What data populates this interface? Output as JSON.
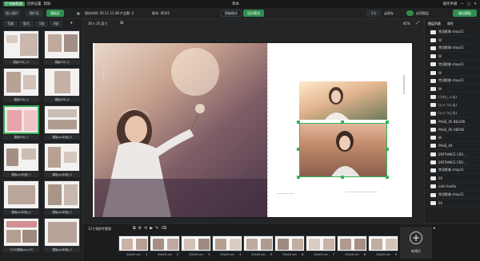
{
  "titlebar": {
    "app_label": "在线编辑器",
    "menu": [
      "在线编辑器",
      "还原设置",
      "帮助"
    ],
    "title": "草本",
    "right_label": "操作手册"
  },
  "topbar": {
    "btn_left": "图片区",
    "btn_layout": "模板区",
    "autosave": "保存时间: 03:11 11:38",
    "page_count": "产品数: 2",
    "version": "版本: 05/01",
    "mode_a": "智能模式",
    "mode_b": "设计模式",
    "zoom_select": "1:1",
    "save_btn": "云保存",
    "toggle_label": "启用图层",
    "publish_btn": "输出模板"
  },
  "leftpanel": {
    "filter_a": "写真",
    "filter_b": "版式",
    "filter_c": "1张",
    "filter_d": "4张",
    "thumbs": [
      {
        "label": "模板PSD_11"
      },
      {
        "label": "模板PSD_9"
      },
      {
        "label": "模板PSD_4"
      },
      {
        "label": "模板PSD_6"
      },
      {
        "label": "模板PSD_2"
      },
      {
        "label": "模板psd封面_8"
      },
      {
        "label": "模板psd封面_7"
      },
      {
        "label": "模板psd封面_6"
      },
      {
        "label": "模板psd封面_4"
      },
      {
        "label": "模板psd封面_5"
      },
      {
        "label": "2020模板psd_49"
      },
      {
        "label": "模板psd封面_3"
      }
    ],
    "footer": "插入图片"
  },
  "canvas": {
    "size_label": "20 x 10 英寸",
    "zoom_label": "85%"
  },
  "rightpanel": {
    "tabs": [
      "图层列表",
      "属性"
    ],
    "layers": [
      "梵语影像 shop11",
      "W",
      "梵语影像 shop11",
      "W",
      "梵语影像 shop11",
      "W",
      "梵语影像 shop11",
      "W",
      "(うれしいな)",
      "(いくつにな)",
      "(いくつにな)",
      "PAGE_05 BELOW",
      "PAGE_05 ABOVE",
      "W",
      "PAGE_04",
      "ENTRANCE CER...",
      "ENTRANCE CER...",
      "梵语影像 shop11",
      "05",
      "mile feuille",
      "梵语影像 shop11",
      "04"
    ]
  },
  "bottombar": {
    "count_label": "12寸相册专题版",
    "pager": "1 / 12",
    "add_page": "新增页",
    "spreads": [
      {
        "size": "20x10 cm",
        "num": "1"
      },
      {
        "size": "20x10 cm",
        "num": "2"
      },
      {
        "size": "20x10 cm",
        "num": "3"
      },
      {
        "size": "20x10 cm",
        "num": "4"
      },
      {
        "size": "20x10 cm",
        "num": "5"
      },
      {
        "size": "20x10 cm",
        "num": "6"
      },
      {
        "size": "20x10 cm",
        "num": "7"
      },
      {
        "size": "20x10 cm",
        "num": "8"
      },
      {
        "size": "20x10 cm",
        "num": "9"
      }
    ]
  },
  "colors": {
    "accent": "#2f8f4e",
    "selection": "#36b25b",
    "bg": "#1b1d1f"
  }
}
